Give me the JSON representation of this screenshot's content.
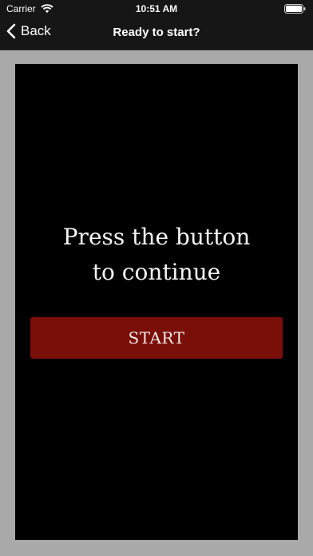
{
  "status_bar": {
    "carrier": "Carrier",
    "time": "10:51 AM",
    "icons": [
      "wifi-icon",
      "battery-icon"
    ]
  },
  "nav": {
    "back_label": "Back",
    "back_icon": "chevron-left-icon",
    "title": "Ready to start?"
  },
  "main": {
    "prompt_line1": "Press the button",
    "prompt_line2": "to continue",
    "start_label": "START"
  },
  "colors": {
    "background": "#a9a9a9",
    "bar": "#161616",
    "panel": "#000000",
    "button": "#7a0f09",
    "text": "#ffffff"
  }
}
